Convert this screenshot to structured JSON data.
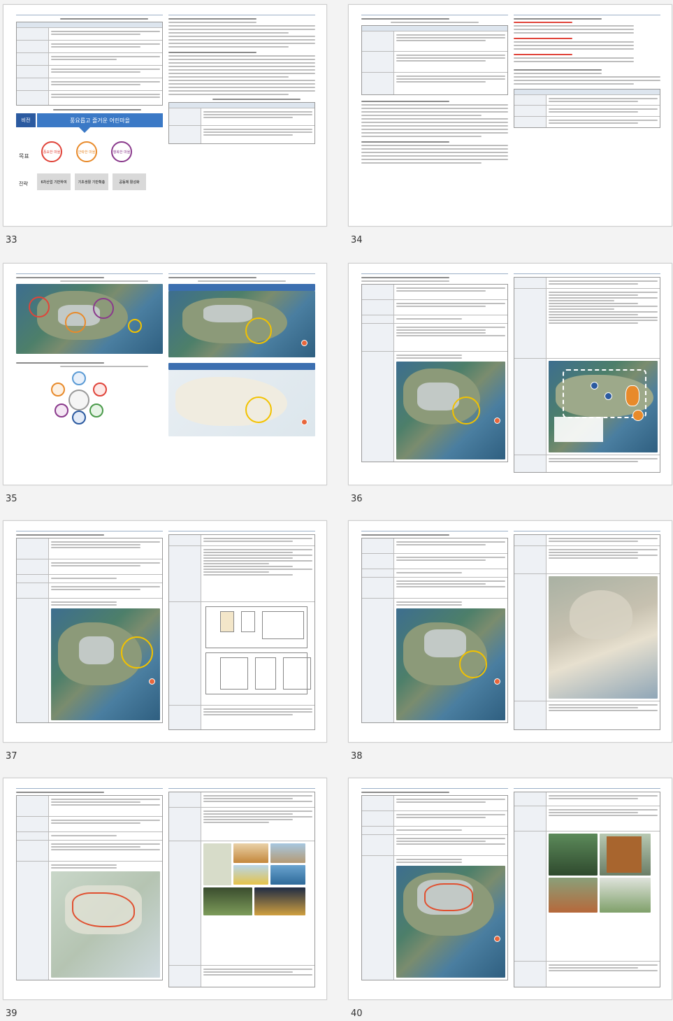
{
  "pages": [
    {
      "number": "33",
      "header": "V. 어촌마을 발전방향 및 추진 계획",
      "vision_label": "비전",
      "vision_text": "풍요롭고 즐거운 어린마을",
      "goal_label": "목표",
      "goals": [
        "풍요한 마을",
        "안락한 마을",
        "행복한 마을"
      ],
      "strategy_label": "전략",
      "strategies": [
        "6차산업 기반하여",
        "기초생활 기반확충",
        "공동체 활성화"
      ]
    },
    {
      "number": "34"
    },
    {
      "number": "35"
    },
    {
      "number": "36"
    },
    {
      "number": "37"
    },
    {
      "number": "38"
    },
    {
      "number": "39"
    },
    {
      "number": "40"
    }
  ],
  "colors": {
    "accent": "#5b9bd5",
    "blue_banner": "#3c6fb0",
    "goal_red": "#e0443a",
    "goal_orange": "#e88a2a",
    "goal_purple": "#8a3a8c"
  }
}
